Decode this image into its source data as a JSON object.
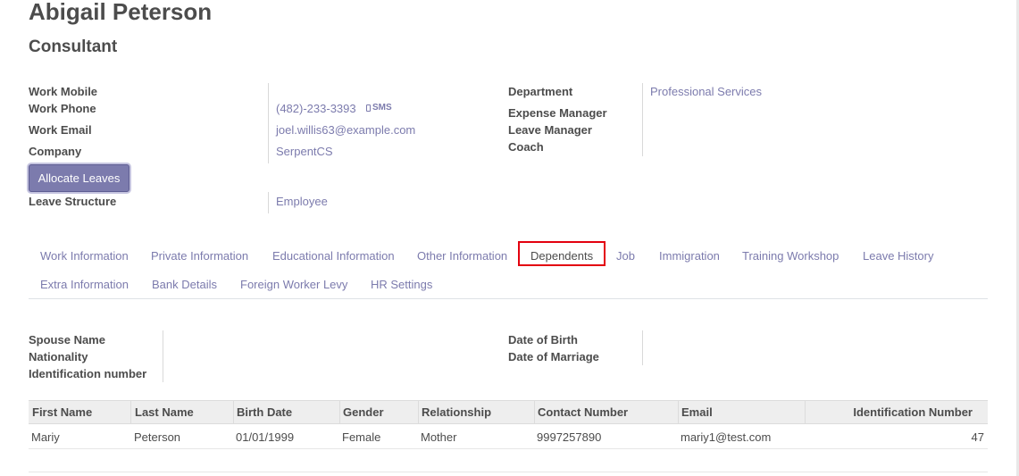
{
  "employee": {
    "name": "Abigail Peterson",
    "job_title": "Consultant"
  },
  "left_fields": {
    "work_mobile_label": "Work Mobile",
    "work_phone_label": "Work Phone",
    "work_phone_value": "(482)-233-3393",
    "sms_label": "SMS",
    "work_email_label": "Work Email",
    "work_email_value": "joel.willis63@example.com",
    "company_label": "Company",
    "company_value": "SerpentCS",
    "leave_structure_label": "Leave Structure",
    "leave_structure_value": "Employee"
  },
  "right_fields": {
    "department_label": "Department",
    "department_value": "Professional Services",
    "expense_manager_label": "Expense Manager",
    "leave_manager_label": "Leave Manager",
    "coach_label": "Coach"
  },
  "actions": {
    "allocate_leaves": "Allocate Leaves"
  },
  "tabs": [
    {
      "label": "Work Information"
    },
    {
      "label": "Private Information"
    },
    {
      "label": "Educational Information"
    },
    {
      "label": "Other Information"
    },
    {
      "label": "Dependents",
      "active": true
    },
    {
      "label": "Job"
    },
    {
      "label": "Immigration"
    },
    {
      "label": "Training Workshop"
    },
    {
      "label": "Leave History"
    },
    {
      "label": "Extra Information"
    },
    {
      "label": "Bank Details"
    },
    {
      "label": "Foreign Worker Levy"
    },
    {
      "label": "HR Settings"
    }
  ],
  "dependents": {
    "spouse_name_label": "Spouse Name",
    "nationality_label": "Nationality",
    "identification_number_label": "Identification number",
    "date_of_birth_label": "Date of Birth",
    "date_of_marriage_label": "Date of Marriage",
    "table": {
      "columns": [
        "First Name",
        "Last Name",
        "Birth Date",
        "Gender",
        "Relationship",
        "Contact Number",
        "Email",
        "Identification Number"
      ],
      "rows": [
        [
          "Mariy",
          "Peterson",
          "01/01/1999",
          "Female",
          "Mother",
          "9997257890",
          "mariy1@test.com",
          "47"
        ]
      ]
    }
  },
  "colors": {
    "accent": "#7c7bad",
    "highlight_box": "#e3000f",
    "text": "#4c4c4c"
  }
}
